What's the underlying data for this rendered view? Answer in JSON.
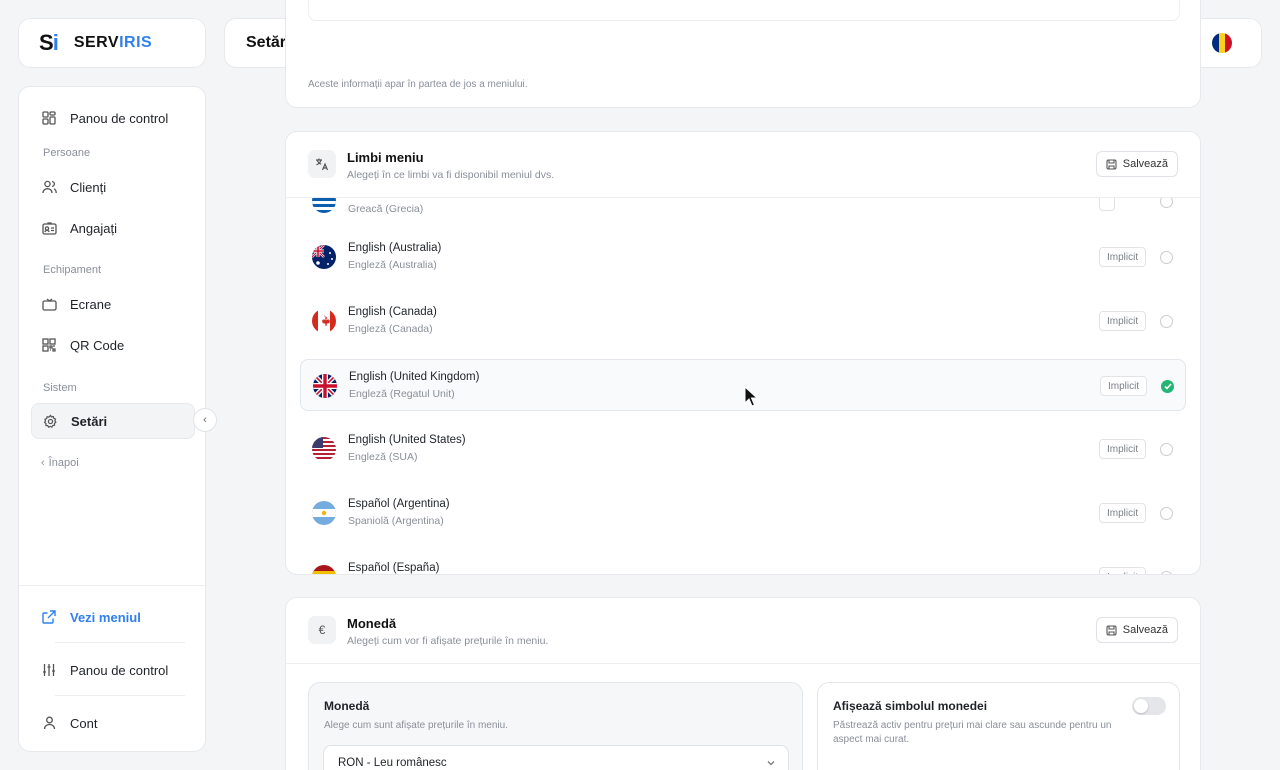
{
  "logo": {
    "mark_s": "S",
    "mark_i": "i",
    "text_a": "SERV",
    "text_b": "IRIS"
  },
  "header": {
    "title": "Setări"
  },
  "sidebar": {
    "items": [
      {
        "label": "Panou de control",
        "icon": "dashboard-icon"
      },
      {
        "label": "Clienți",
        "icon": "users-icon"
      },
      {
        "label": "Angajați",
        "icon": "id-card-icon"
      },
      {
        "label": "Ecrane",
        "icon": "tv-icon"
      },
      {
        "label": "QR Code",
        "icon": "qr-icon"
      },
      {
        "label": "Setări",
        "icon": "gear-icon",
        "active": true
      }
    ],
    "sections": [
      "Persoane",
      "Echipament",
      "Sistem"
    ],
    "back_label": "Înapoi",
    "bottom": [
      {
        "label": "Vezi meniul",
        "icon": "external-link-icon"
      },
      {
        "label": "Panou de control",
        "icon": "sliders-icon"
      },
      {
        "label": "Cont",
        "icon": "user-icon"
      }
    ]
  },
  "top_card": {
    "note": "Aceste informații apar în partea de jos a meniului."
  },
  "languages": {
    "title": "Limbi meniu",
    "subtitle": "Alegeți în ce limbi va fi disponibil meniul dvs.",
    "save_label": "Salvează",
    "default_label": "Implicit",
    "rows": [
      {
        "name": "",
        "local": "Greacă (Grecia)",
        "flag": "greece",
        "selected": false
      },
      {
        "name": "English (Australia)",
        "local": "Engleză (Australia)",
        "flag": "australia",
        "selected": false
      },
      {
        "name": "English (Canada)",
        "local": "Engleză (Canada)",
        "flag": "canada",
        "selected": false
      },
      {
        "name": "English (United Kingdom)",
        "local": "Engleză (Regatul Unit)",
        "flag": "uk",
        "selected": true
      },
      {
        "name": "English (United States)",
        "local": "Engleză (SUA)",
        "flag": "usa",
        "selected": false
      },
      {
        "name": "Español (Argentina)",
        "local": "Spaniolă (Argentina)",
        "flag": "argentina",
        "selected": false
      },
      {
        "name": "Español (España)",
        "local": "",
        "flag": "spain",
        "selected": false
      }
    ]
  },
  "currency": {
    "title": "Monedă",
    "subtitle": "Alegeți cum vor fi afișate prețurile în meniu.",
    "save_label": "Salvează",
    "icon_glyph": "€",
    "box_left": {
      "title": "Monedă",
      "subtitle": "Alege cum sunt afișate prețurile în meniu.",
      "selected": "RON - Leu românesc"
    },
    "box_right": {
      "title": "Afișează simbolul monedei",
      "subtitle": "Păstrează activ pentru prețuri mai clare sau ascunde pentru un aspect mai curat."
    }
  },
  "colors": {
    "accent": "#2f80ed",
    "success": "#22b573"
  }
}
